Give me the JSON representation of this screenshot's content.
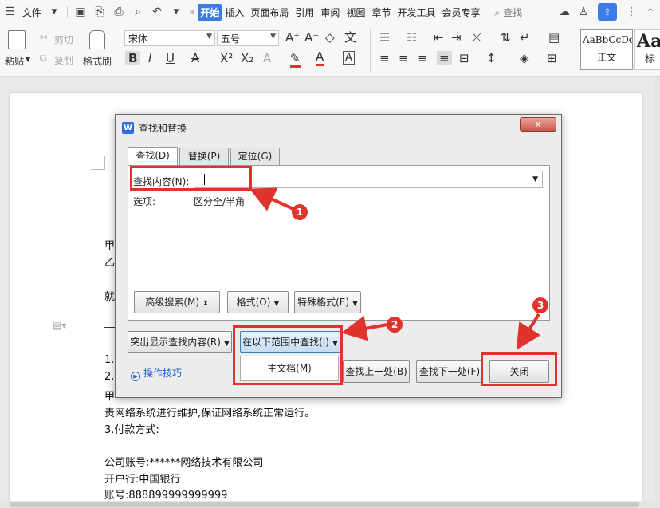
{
  "menubar": {
    "file": "文件",
    "more": "»",
    "tabs": [
      "开始",
      "插入",
      "页面布局",
      "引用",
      "审阅",
      "视图",
      "章节",
      "开发工具",
      "会员专享"
    ],
    "search": "查找"
  },
  "ribbon": {
    "paste": "粘贴",
    "cut": "剪切",
    "copy": "复制",
    "format_painter": "格式刷",
    "font_name": "宋体",
    "font_size": "五号",
    "style_preview_1": "AaBbCcDd",
    "style_name_1": "正文",
    "style_preview_2": "AaB",
    "style_name_2": "标"
  },
  "document": {
    "lines": [
      "甲",
      "乙",
      "就",
      "1.",
      "2.",
      "甲",
      "责网络系统进行维护,保证网络系统正常运行。",
      "3.付款方式:",
      "公司账号:******网络技术有限公司",
      "开户行:中国银行",
      "账号:888899999999999"
    ]
  },
  "dialog": {
    "title": "查找和替换",
    "close": "x",
    "tabs": [
      "查找(D)",
      "替换(P)",
      "定位(G)"
    ],
    "find_label": "查找内容(N):",
    "find_value": "",
    "options_label": "选项:",
    "options_value": "区分全/半角",
    "advanced_search": "高级搜索(M)",
    "format": "格式(O)",
    "special_format": "特殊格式(E)",
    "highlight": "突出显示查找内容(R)",
    "find_in_range": "在以下范围中查找(I)",
    "main_document": "主文档(M)",
    "find_previous": "查找上一处(B)",
    "find_next": "查找下一处(F)",
    "close_button": "关闭",
    "tips": "操作技巧"
  },
  "annotations": {
    "badges": [
      "1",
      "2",
      "3"
    ],
    "color": "#e0332e"
  },
  "colors": {
    "accent": "#3b7de8",
    "annotation_red": "#e0332e",
    "link_blue": "#1f63c6"
  }
}
